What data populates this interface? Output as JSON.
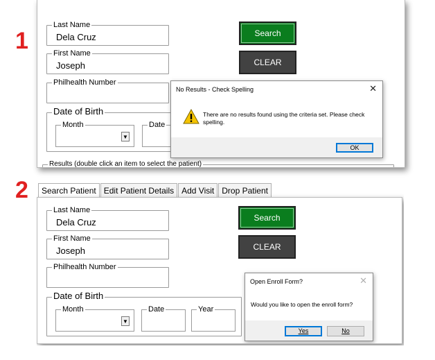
{
  "steps": {
    "one": "1",
    "two": "2"
  },
  "panel1": {
    "last_name_label": "Last Name",
    "last_name_value": "Dela Cruz",
    "first_name_label": "First Name",
    "first_name_value": "Joseph",
    "philhealth_label": "Philhealth Number",
    "philhealth_value": "",
    "dob_label": "Date of Birth",
    "month_label": "Month",
    "date_label": "Date",
    "search_label": "Search",
    "clear_label": "CLEAR",
    "results_label": "Results (double click an item to select the patient)",
    "dialog": {
      "title": "No Results - Check Spelling",
      "message": "There are no results found using the criteria set. Please check spelling.",
      "ok_label": "OK",
      "close_glyph": "✕",
      "icon": "warning-icon"
    }
  },
  "panel2": {
    "tabs": [
      "Search Patient",
      "Edit Patient Details",
      "Add Visit",
      "Drop Patient"
    ],
    "last_name_label": "Last Name",
    "last_name_value": "Dela Cruz",
    "first_name_label": "First Name",
    "first_name_value": "Joseph",
    "philhealth_label": "Philhealth Number",
    "philhealth_value": "",
    "dob_label": "Date of Birth",
    "month_label": "Month",
    "date_label": "Date",
    "year_label": "Year",
    "search_label": "Search",
    "clear_label": "CLEAR",
    "dialog": {
      "title": "Open Enroll Form?",
      "message": "Would you like to open the enroll form?",
      "yes_label": "Yes",
      "no_label": "No",
      "close_glyph": "✕"
    }
  },
  "colors": {
    "step_number": "#e02020",
    "search_button": "#0a7d1e",
    "clear_button": "#424242",
    "warning": "#f5c400"
  }
}
